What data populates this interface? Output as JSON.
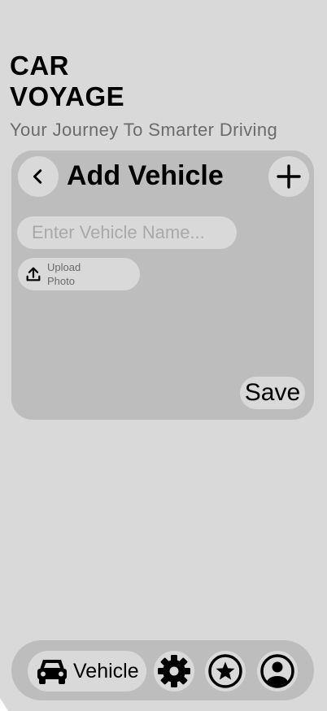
{
  "app": {
    "brand_line1": "CAR",
    "brand_line2": "VOYAGE",
    "tagline": "Your Journey To Smarter Driving"
  },
  "add_vehicle_card": {
    "title": "Add Vehicle",
    "back_icon": "chevron-left-icon",
    "add_icon": "plus-icon",
    "name_input": {
      "value": "",
      "placeholder": "Enter Vehicle Name..."
    },
    "upload": {
      "icon": "upload-icon",
      "label": "Upload Photo"
    },
    "save_label": "Save"
  },
  "bottom_nav": {
    "items": [
      {
        "icon": "car-icon",
        "label": "Vehicle",
        "active": true
      },
      {
        "icon": "gear-icon",
        "label": ""
      },
      {
        "icon": "star-icon",
        "label": ""
      },
      {
        "icon": "user-icon",
        "label": ""
      }
    ]
  },
  "colors": {
    "background": "#d9d9d9",
    "card": "#bdbdbd",
    "text": "#000000",
    "muted_text": "#6b6b6b",
    "placeholder": "#a9a9a9"
  }
}
